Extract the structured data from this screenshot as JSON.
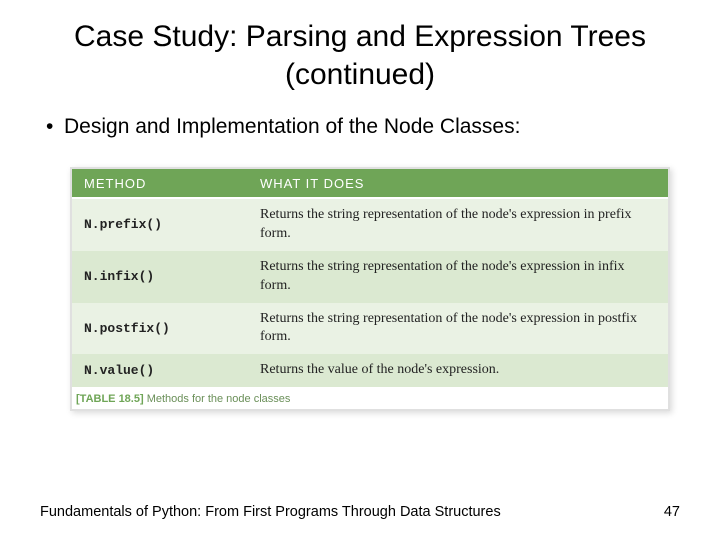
{
  "title": "Case Study: Parsing and Expression Trees (continued)",
  "bullet": "Design and Implementation of the Node Classes:",
  "table": {
    "headers": {
      "method": "METHOD",
      "desc": "WHAT IT DOES"
    },
    "rows": [
      {
        "method": "N.prefix()",
        "desc": "Returns the string representation of the node's expression in prefix form."
      },
      {
        "method": "N.infix()",
        "desc": "Returns the string representation of the node's expression in infix form."
      },
      {
        "method": "N.postfix()",
        "desc": "Returns the string representation of the node's expression in postfix form."
      },
      {
        "method": "N.value()",
        "desc": "Returns the value of the node's expression."
      }
    ],
    "caption_label": "[TABLE 18.5]",
    "caption_text": " Methods for the node classes"
  },
  "footer": {
    "left": "Fundamentals of Python: From First Programs Through Data Structures",
    "right": "47"
  }
}
